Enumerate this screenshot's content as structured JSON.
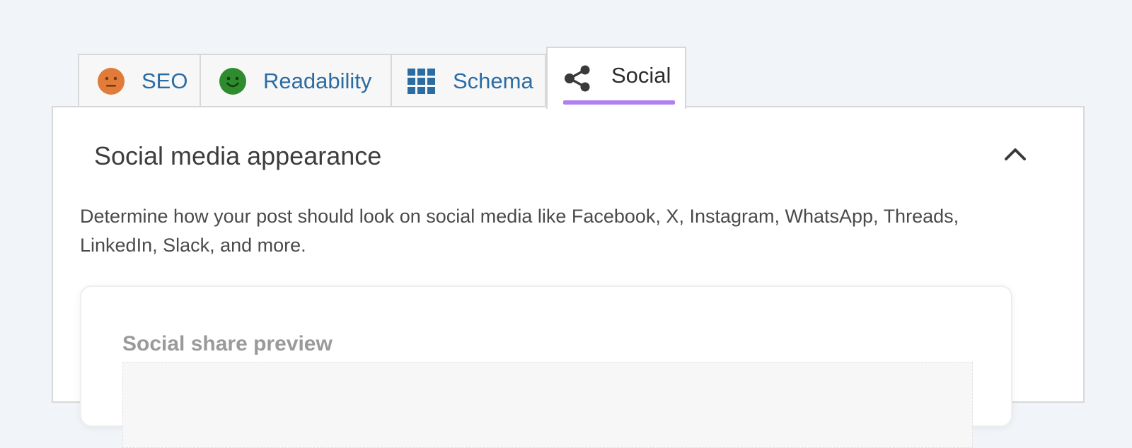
{
  "tabs": [
    {
      "label": "SEO",
      "icon": "neutral-face-icon",
      "icon_color": "#e07b39"
    },
    {
      "label": "Readability",
      "icon": "smiley-face-icon",
      "icon_color": "#2e8b2e"
    },
    {
      "label": "Schema",
      "icon": "grid-icon",
      "icon_color": "#2b6ca3"
    },
    {
      "label": "Social",
      "icon": "share-icon",
      "icon_color": "#3a3a3a",
      "active": true
    }
  ],
  "colors": {
    "active_underline": "#b27ff0",
    "link": "#2b6ca3",
    "background": "#f1f4f8"
  },
  "panel": {
    "title": "Social media appearance",
    "collapse_icon": "chevron-up-icon",
    "description": "Determine how your post should look on social media like Facebook, X, Instagram, WhatsApp, Threads, LinkedIn, Slack, and more.",
    "preview": {
      "title": "Social share preview"
    }
  }
}
